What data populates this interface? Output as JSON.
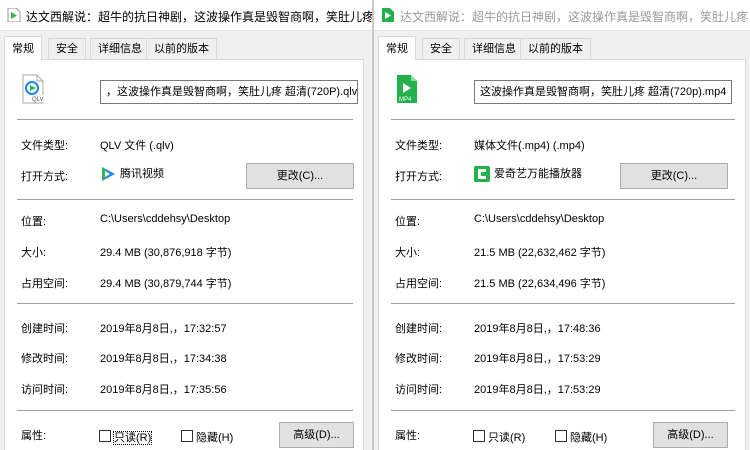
{
  "left": {
    "title": "达文西解说：超牛的抗日神剧，这波操作真是毁智商啊，笑肚儿疼",
    "tabs": [
      "常规",
      "安全",
      "详细信息",
      "以前的版本"
    ],
    "filename": "，这波操作真是毁智商啊，笑肚儿疼 超清(720P).qlv",
    "icon_label": "QLV",
    "file_type_label": "文件类型:",
    "file_type": "QLV 文件 (.qlv)",
    "open_with_label": "打开方式:",
    "open_with": "腾讯视频",
    "change_button": "更改(C)...",
    "location_label": "位置:",
    "location": "C:\\Users\\cddehsy\\Desktop",
    "size_label": "大小:",
    "size": "29.4 MB (30,876,918 字节)",
    "disk_label": "占用空间:",
    "disk": "29.4 MB (30,879,744 字节)",
    "created_label": "创建时间:",
    "created": "2019年8月8日,，17:32:57",
    "modified_label": "修改时间:",
    "modified": "2019年8月8日,，17:34:38",
    "accessed_label": "访问时间:",
    "accessed": "2019年8月8日,，17:35:56",
    "attr_label": "属性:",
    "readonly": "只读(R)",
    "hidden": "隐藏(H)",
    "advanced_button": "高级(D)..."
  },
  "right": {
    "title": "达文西解说：超牛的抗日神剧，这波操作真是毁智商啊，笑肚儿疼",
    "tabs": [
      "常规",
      "安全",
      "详细信息",
      "以前的版本"
    ],
    "filename": "这波操作真是毁智商啊，笑肚儿疼 超清(720p).mp4",
    "icon_label": "MP4",
    "file_type_label": "文件类型:",
    "file_type": "媒体文件(.mp4) (.mp4)",
    "open_with_label": "打开方式:",
    "open_with": "爱奇艺万能播放器",
    "change_button": "更改(C)...",
    "location_label": "位置:",
    "location": "C:\\Users\\cddehsy\\Desktop",
    "size_label": "大小:",
    "size": "21.5 MB (22,632,462 字节)",
    "disk_label": "占用空间:",
    "disk": "21.5 MB (22,634,496 字节)",
    "created_label": "创建时间:",
    "created": "2019年8月8日,，17:48:36",
    "modified_label": "修改时间:",
    "modified": "2019年8月8日,，17:53:29",
    "accessed_label": "访问时间:",
    "accessed": "2019年8月8日,，17:53:29",
    "attr_label": "属性:",
    "readonly": "只读(R)",
    "hidden": "隐藏(H)",
    "advanced_button": "高级(D)..."
  },
  "colors": {
    "qlv_green": "#3ab54a",
    "qlv_blue": "#1e88e5",
    "mp4_green": "#22b14c"
  }
}
